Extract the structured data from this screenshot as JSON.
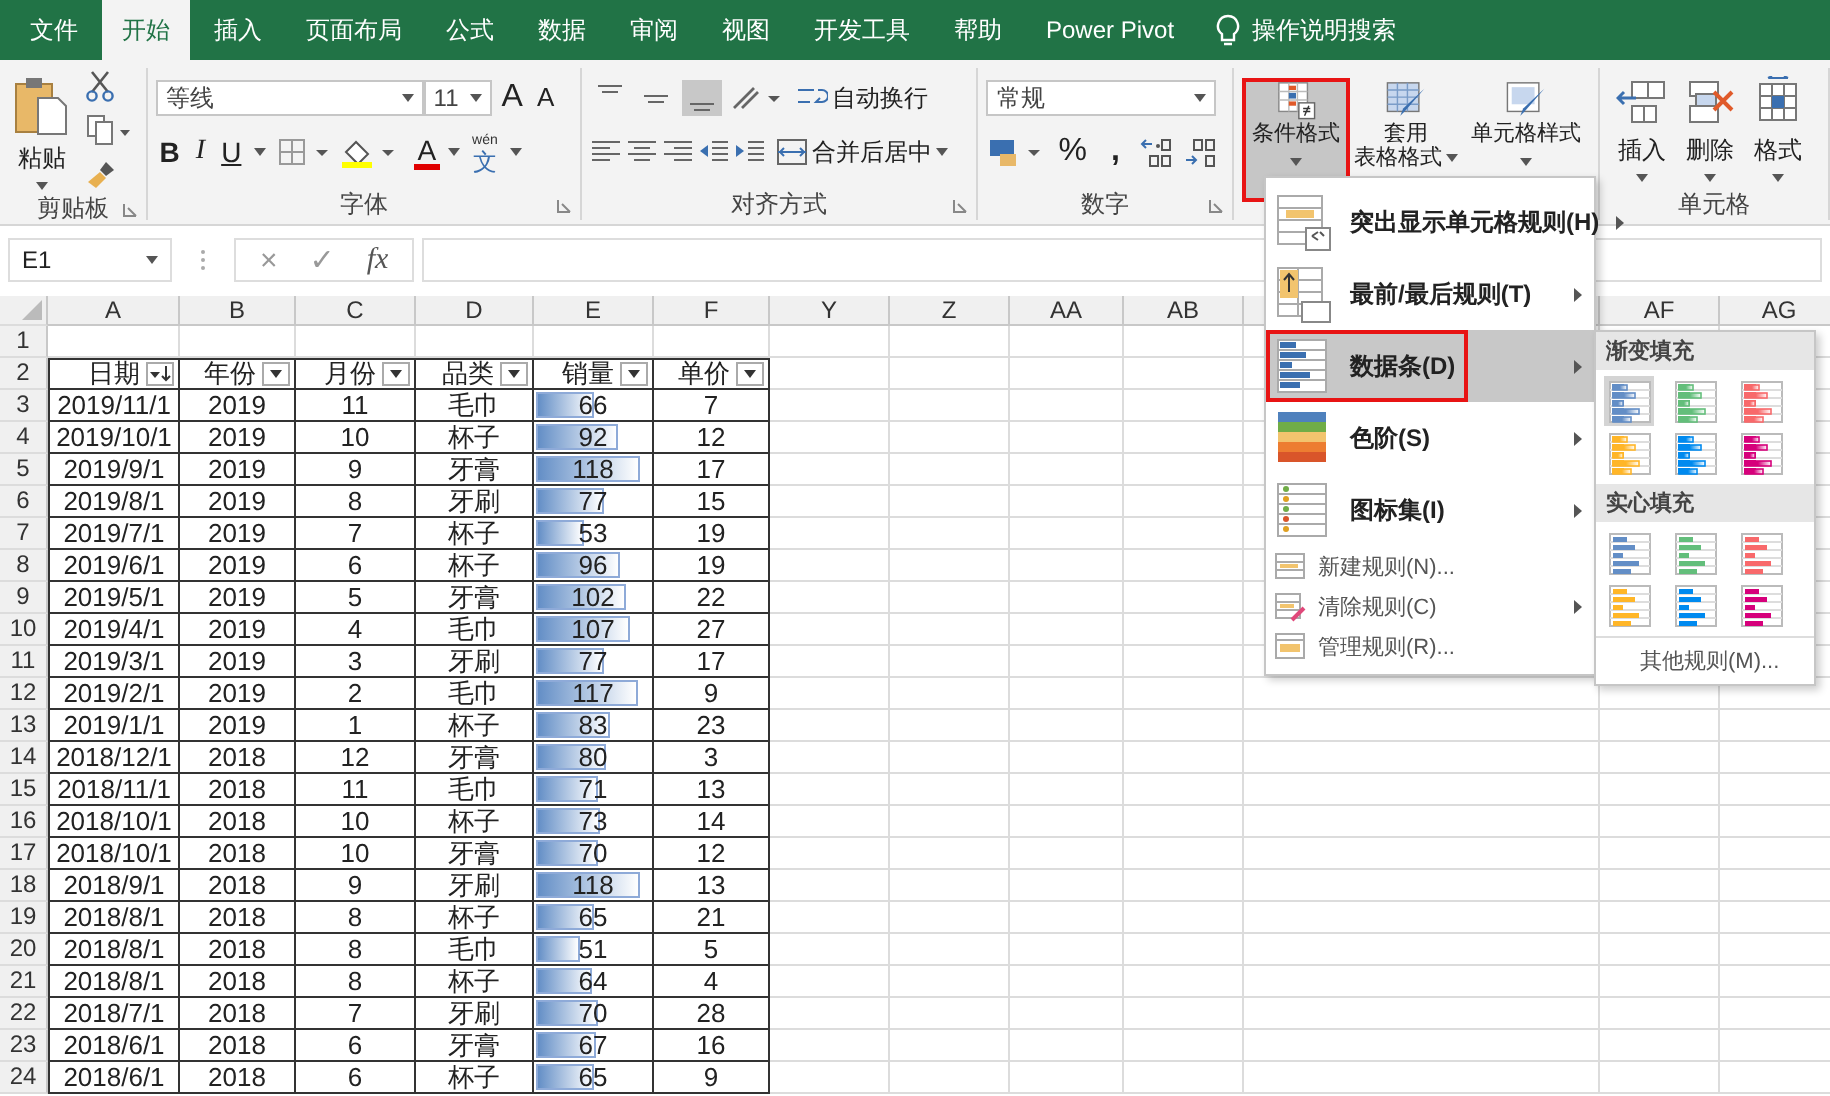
{
  "tabs": [
    {
      "label": "文件",
      "selected": false
    },
    {
      "label": "开始",
      "selected": true
    },
    {
      "label": "插入",
      "selected": false
    },
    {
      "label": "页面布局",
      "selected": false
    },
    {
      "label": "公式",
      "selected": false
    },
    {
      "label": "数据",
      "selected": false
    },
    {
      "label": "审阅",
      "selected": false
    },
    {
      "label": "视图",
      "selected": false
    },
    {
      "label": "开发工具",
      "selected": false
    },
    {
      "label": "帮助",
      "selected": false
    },
    {
      "label": "Power Pivot",
      "selected": false
    }
  ],
  "tell_me": "操作说明搜索",
  "ribbon": {
    "clipboard": {
      "label": "剪贴板",
      "paste": "粘贴"
    },
    "font": {
      "label": "字体",
      "font_name": "等线",
      "font_size": "11",
      "grow": "A",
      "shrink": "A",
      "bold": "B",
      "italic": "I",
      "underline": "U",
      "font_color": "A",
      "phonetic_top": "wén",
      "phonetic_char": "文"
    },
    "alignment": {
      "label": "对齐方式",
      "vertical_align": [
        {
          "selected": false
        },
        {
          "selected": false
        },
        {
          "selected": true
        }
      ],
      "wrap_text": "自动换行",
      "merge_center": "合并后居中"
    },
    "number": {
      "label": "数字",
      "format": "常规",
      "percent": "%",
      "comma": ","
    },
    "styles": [
      {
        "lines": [
          "条件格式"
        ],
        "selected": true
      },
      {
        "lines": [
          "套用",
          "表格格式"
        ],
        "selected": false
      },
      {
        "lines": [
          "单元格样式"
        ],
        "selected": false
      }
    ],
    "cells": {
      "label": "单元格",
      "buttons": [
        "插入",
        "删除",
        "格式"
      ]
    }
  },
  "formula_bar": {
    "name_box": "E1",
    "cancel": "×",
    "enter": "✓",
    "function": "fx"
  },
  "sheet": {
    "columns": [
      "A",
      "B",
      "C",
      "D",
      "E",
      "F",
      "Y",
      "Z",
      "AA",
      "AB",
      "AF",
      "AG"
    ],
    "blank_row": "1",
    "header_row": {
      "number": "2",
      "cells": [
        {
          "label": "日期",
          "kind": "sorted"
        },
        {
          "label": "年份",
          "kind": "plain"
        },
        {
          "label": "月份",
          "kind": "plain"
        },
        {
          "label": "品类",
          "kind": "plain"
        },
        {
          "label": "销量",
          "kind": "plain"
        },
        {
          "label": "单价",
          "kind": "plain"
        }
      ]
    },
    "rows": [
      {
        "number": "3",
        "date": "2019/11/1",
        "year": "2019",
        "month": "11",
        "category": "毛巾",
        "sales": "66",
        "level": 0.49,
        "price": "7"
      },
      {
        "number": "4",
        "date": "2019/10/1",
        "year": "2019",
        "month": "10",
        "category": "杯子",
        "sales": "92",
        "level": 0.69,
        "price": "12"
      },
      {
        "number": "5",
        "date": "2019/9/1",
        "year": "2019",
        "month": "9",
        "category": "牙膏",
        "sales": "118",
        "level": 0.88,
        "price": "17"
      },
      {
        "number": "6",
        "date": "2019/8/1",
        "year": "2019",
        "month": "8",
        "category": "牙刷",
        "sales": "77",
        "level": 0.57,
        "price": "15"
      },
      {
        "number": "7",
        "date": "2019/7/1",
        "year": "2019",
        "month": "7",
        "category": "杯子",
        "sales": "53",
        "level": 0.4,
        "price": "19"
      },
      {
        "number": "8",
        "date": "2019/6/1",
        "year": "2019",
        "month": "6",
        "category": "杯子",
        "sales": "96",
        "level": 0.72,
        "price": "19"
      },
      {
        "number": "9",
        "date": "2019/5/1",
        "year": "2019",
        "month": "5",
        "category": "牙膏",
        "sales": "102",
        "level": 0.76,
        "price": "22"
      },
      {
        "number": "10",
        "date": "2019/4/1",
        "year": "2019",
        "month": "4",
        "category": "毛巾",
        "sales": "107",
        "level": 0.8,
        "price": "27"
      },
      {
        "number": "11",
        "date": "2019/3/1",
        "year": "2019",
        "month": "3",
        "category": "牙刷",
        "sales": "77",
        "level": 0.57,
        "price": "17"
      },
      {
        "number": "12",
        "date": "2019/2/1",
        "year": "2019",
        "month": "2",
        "category": "毛巾",
        "sales": "117",
        "level": 0.87,
        "price": "9"
      },
      {
        "number": "13",
        "date": "2019/1/1",
        "year": "2019",
        "month": "1",
        "category": "杯子",
        "sales": "83",
        "level": 0.62,
        "price": "23"
      },
      {
        "number": "14",
        "date": "2018/12/1",
        "year": "2018",
        "month": "12",
        "category": "牙膏",
        "sales": "80",
        "level": 0.6,
        "price": "3"
      },
      {
        "number": "15",
        "date": "2018/11/1",
        "year": "2018",
        "month": "11",
        "category": "毛巾",
        "sales": "71",
        "level": 0.53,
        "price": "13"
      },
      {
        "number": "16",
        "date": "2018/10/1",
        "year": "2018",
        "month": "10",
        "category": "杯子",
        "sales": "73",
        "level": 0.54,
        "price": "14"
      },
      {
        "number": "17",
        "date": "2018/10/1",
        "year": "2018",
        "month": "10",
        "category": "牙膏",
        "sales": "70",
        "level": 0.52,
        "price": "12"
      },
      {
        "number": "18",
        "date": "2018/9/1",
        "year": "2018",
        "month": "9",
        "category": "牙刷",
        "sales": "118",
        "level": 0.88,
        "price": "13"
      },
      {
        "number": "19",
        "date": "2018/8/1",
        "year": "2018",
        "month": "8",
        "category": "杯子",
        "sales": "65",
        "level": 0.49,
        "price": "21"
      },
      {
        "number": "20",
        "date": "2018/8/1",
        "year": "2018",
        "month": "8",
        "category": "毛巾",
        "sales": "51",
        "level": 0.38,
        "price": "5"
      },
      {
        "number": "21",
        "date": "2018/8/1",
        "year": "2018",
        "month": "8",
        "category": "杯子",
        "sales": "64",
        "level": 0.48,
        "price": "4"
      },
      {
        "number": "22",
        "date": "2018/7/1",
        "year": "2018",
        "month": "7",
        "category": "牙刷",
        "sales": "70",
        "level": 0.52,
        "price": "28"
      },
      {
        "number": "23",
        "date": "2018/6/1",
        "year": "2018",
        "month": "6",
        "category": "牙膏",
        "sales": "67",
        "level": 0.5,
        "price": "16"
      },
      {
        "number": "24",
        "date": "2018/6/1",
        "year": "2018",
        "month": "6",
        "category": "杯子",
        "sales": "65",
        "level": 0.49,
        "price": "9"
      }
    ]
  },
  "conditional_format_menu": {
    "items": [
      {
        "label": "突出显示单元格规则(H)",
        "kind": "large",
        "submenu": true,
        "selected": false
      },
      {
        "label": "最前/最后规则(T)",
        "kind": "large",
        "submenu": true,
        "selected": false
      },
      {
        "label": "数据条(D)",
        "kind": "large",
        "submenu": true,
        "selected": true
      },
      {
        "label": "色阶(S)",
        "kind": "large",
        "submenu": true,
        "selected": false
      },
      {
        "label": "图标集(I)",
        "kind": "large",
        "submenu": true,
        "selected": false
      },
      {
        "label": "新建规则(N)...",
        "kind": "small",
        "submenu": false,
        "selected": false
      },
      {
        "label": "清除规则(C)",
        "kind": "small",
        "submenu": true,
        "selected": false
      },
      {
        "label": "管理规则(R)...",
        "kind": "small",
        "submenu": false,
        "selected": false
      }
    ],
    "data_bar_submenu": {
      "sections": [
        {
          "title": "渐变填充",
          "kind": "gradient",
          "options": [
            {
              "color": "#638ec6",
              "selected": true
            },
            {
              "color": "#63be7b",
              "selected": false
            },
            {
              "color": "#f8696b",
              "selected": false
            },
            {
              "color": "#ffb628",
              "selected": false
            },
            {
              "color": "#008aef",
              "selected": false
            },
            {
              "color": "#d6007b",
              "selected": false
            }
          ]
        },
        {
          "title": "实心填充",
          "kind": "solid",
          "options": [
            {
              "color": "#638ec6",
              "selected": false
            },
            {
              "color": "#63be7b",
              "selected": false
            },
            {
              "color": "#f8696b",
              "selected": false
            },
            {
              "color": "#ffb628",
              "selected": false
            },
            {
              "color": "#008aef",
              "selected": false
            },
            {
              "color": "#d6007b",
              "selected": false
            }
          ]
        }
      ],
      "more": "其他规则(M)..."
    }
  }
}
